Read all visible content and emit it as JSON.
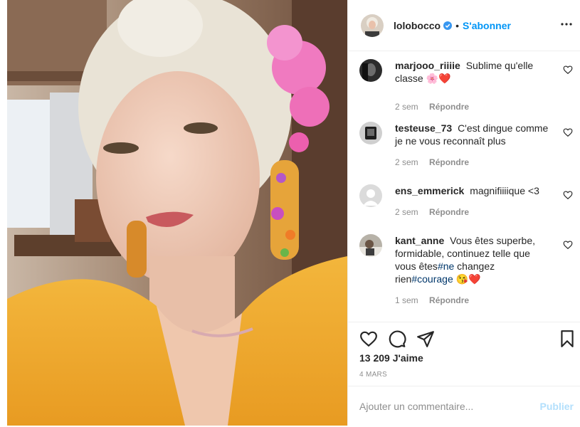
{
  "post": {
    "username": "lolobocco",
    "follow_label": "S'abonner",
    "dot": "•",
    "likes": "13 209 J'aime",
    "date": "4 MARS"
  },
  "comments": [
    {
      "user": "marjooo_riiiie",
      "text": "Sublime qu'elle classe",
      "emoji": "🌸❤️",
      "time": "2 sem",
      "reply": "Répondre"
    },
    {
      "user": "testeuse_73",
      "text": "C'est dingue comme je ne vous reconnaît plus",
      "time": "2 sem",
      "reply": "Répondre"
    },
    {
      "user": "ens_emmerick",
      "text": "magnifiiiique <3",
      "time": "2 sem",
      "reply": "Répondre"
    },
    {
      "user": "kant_anne",
      "text_a": "Vous êtes superbe, formidable, continuez telle que vous êtes",
      "tag1": "#ne",
      "text_b": " changez rien",
      "tag2": "#courage",
      "emoji": "😘❤️",
      "time": "1 sem",
      "reply": "Répondre"
    }
  ],
  "add_comment": {
    "placeholder": "Ajouter un commentaire...",
    "publish": "Publier"
  },
  "icons": [
    "verified-badge-icon",
    "more-options-icon",
    "heart-icon",
    "comment-icon",
    "share-icon",
    "bookmark-icon"
  ],
  "colors": {
    "accent": "#0095f6",
    "publish_disabled": "#b2dffc",
    "text": "#262626",
    "muted": "#8e8e8e",
    "like_red": "#ed4956"
  }
}
